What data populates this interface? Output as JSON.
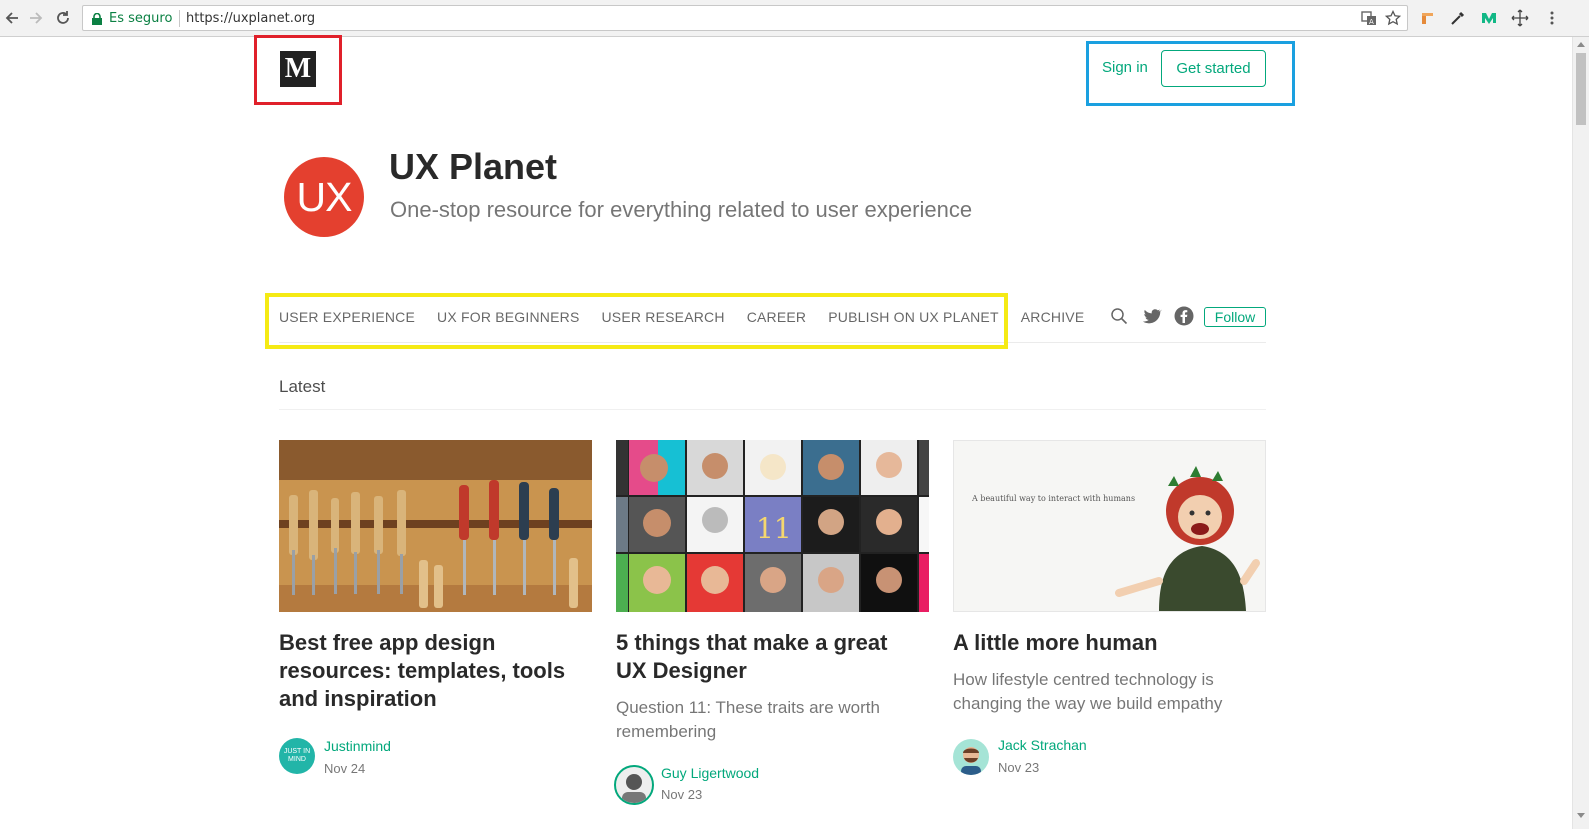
{
  "browser": {
    "secure_label": "Es seguro",
    "url": "https://uxplanet.org"
  },
  "header": {
    "logo_letter": "M",
    "sign_in": "Sign in",
    "get_started": "Get started"
  },
  "publication": {
    "logo_text": "UX",
    "logo_color": "#e4402f",
    "title": "UX Planet",
    "tagline": "One-stop resource for everything related to user experience"
  },
  "nav": {
    "items": [
      "USER EXPERIENCE",
      "UX FOR BEGINNERS",
      "USER RESEARCH",
      "CAREER",
      "PUBLISH ON UX PLANET",
      "ARCHIVE"
    ],
    "follow": "Follow"
  },
  "section": {
    "latest": "Latest"
  },
  "articles": [
    {
      "title": "Best free app design resources: templates, tools and inspiration",
      "subtitle": "",
      "author": "Justinmind",
      "date": "Nov 24",
      "avatar_text": "JUST IN MIND"
    },
    {
      "title": "5 things that make a great UX Designer",
      "subtitle": "Question 11: These traits are worth remembering",
      "author": "Guy Ligertwood",
      "date": "Nov 23",
      "thumb_tile_text": "11"
    },
    {
      "title": "A little more human",
      "subtitle": "How lifestyle centred technology is changing the way we build empathy",
      "author": "Jack Strachan",
      "date": "Nov 23",
      "thumb_caption": "A beautiful way to interact with humans"
    }
  ],
  "colors": {
    "accent": "#03a87c",
    "annotation_red": "#e0202a",
    "annotation_blue": "#1aa0e0",
    "annotation_yellow": "#f5ea14"
  }
}
